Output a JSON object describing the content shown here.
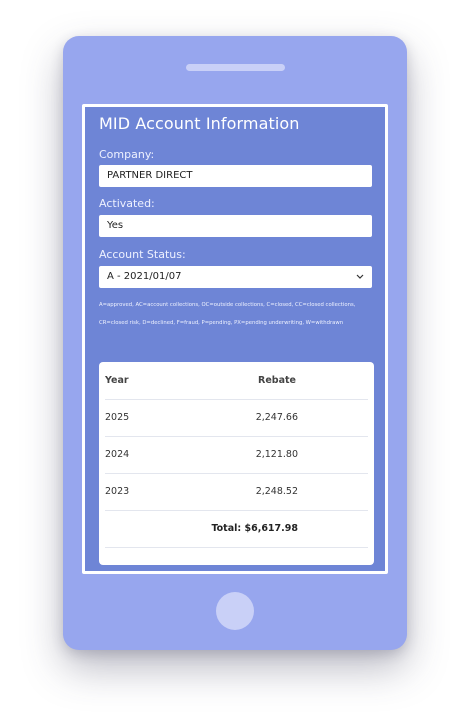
{
  "app": {
    "title": "MID Account Information"
  },
  "form": {
    "company_label": "Company:",
    "company_value": "PARTNER DIRECT",
    "activated_label": "Activated:",
    "activated_value": "Yes",
    "status_label": "Account Status:",
    "status_value": "A - 2021/01/07"
  },
  "legend": {
    "line1": "A=approved, AC=account collections, OC=outside collections, C=closed, CC=closed collections,",
    "line2": "CR=closed risk, D=declined, F=fraud, P=pending, PX=pending underwriting, W=withdrawn"
  },
  "table": {
    "headers": [
      "Year",
      "Rebate"
    ],
    "rows": [
      {
        "year": "2025",
        "rebate": "2,247.66"
      },
      {
        "year": "2024",
        "rebate": "2,121.80"
      },
      {
        "year": "2023",
        "rebate": "2,248.52"
      }
    ],
    "total": "Total: $6,617.98"
  },
  "icons": {
    "select_caret": "chevron-down-icon"
  },
  "colors": {
    "device": "#97a6ee",
    "screen_bg": "#6e85d6",
    "device_accent": "#c9d0f7"
  }
}
